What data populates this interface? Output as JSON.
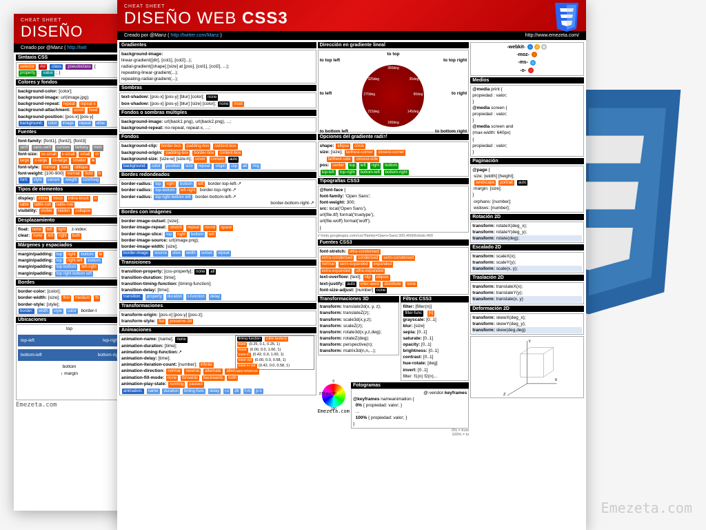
{
  "logo_alt": "CSS3",
  "header": {
    "eyebrow": "CHEAT SHEET",
    "title_a": "DISEÑO WEB ",
    "title_b": "CSS3",
    "author_label": "Creado por @Manz ( ",
    "author_url": "http://twitter.com/Manz",
    "author_close": " )",
    "site": "http://www.emezeta.com/"
  },
  "back": {
    "eyebrow": "CHEAT SHEET",
    "title": "DISEÑO",
    "author_label": "Creado por @Manz ( ",
    "author_url": "http://twit",
    "sections": {
      "sintaxis": "Sintaxis CSS",
      "sintaxis_line1": "selector #id .class :pseudoclass {",
      "sintaxis_line2": "property : value ; }",
      "colores": "Colores y fondos",
      "fuentes": "Fuentes",
      "tipos": "Tipos de elementos",
      "desplaz": "Desplazamiento",
      "margenes": "Márgenes y espaciados",
      "bordes": "Bordes",
      "ubicaciones": "Ubicaciones"
    },
    "colores_lines": [
      "background-color: [color];",
      "background-image: url(image.jpg);",
      "background-repeat: repeat repeat-x",
      "background-attachment: scroll fixed",
      "background-position: [pos-x] [pos-y]",
      "background: color image repeat attac"
    ],
    "fuentes_lines": [
      "font-family: [font1], [font2], [font3]",
      "serif sans-serif cursive fantasy mon",
      "font-size: xx-small x-small small m",
      "large x-large xx-large smaller la",
      "font-style: normal italic oblique",
      "font-weight: [100-900] normal bold b",
      "font: style variant weight size/heig"
    ],
    "tipos_lines": [
      "display: inline block inline-block n",
      "table table-cell table-row",
      "visibility: visible hidden collapse"
    ],
    "desplaz_lines": [
      "float: none left right   z-index:",
      "clear: none left right both"
    ],
    "margenes_lines": [
      "margin/padding: top right bottom le",
      "margin/padding: top left-right botto",
      "margin/padding: top-bottom left-right",
      "margin/padding: top right bottom left"
    ],
    "bordes_lines": [
      "border-color: [color];",
      "border-width: [size]; thin medium th",
      "border-style: [style];",
      "border: width style color   border-t"
    ],
    "ubic_labels": [
      "top",
      "top-left",
      "top-righ",
      "bottom-left",
      "bottom-rig",
      "bottom",
      "margin"
    ]
  },
  "front": {
    "col1": {
      "gradientes": {
        "title": "Gradientes",
        "lines": [
          "background-image:",
          "  linear-gradient([dir], [col1], [col2]...);",
          "  radial-gradient([shape] [size] at [pos], [col1], [col2], ...);",
          "  repeating-linear-gradient(...);",
          "  repeating-radial-gradient(...);"
        ]
      },
      "sombras": {
        "title": "Sombras",
        "lines": [
          "text-shadow: [pos-x] [pos-y] [blur] [color]; none",
          "box-shadow: [pos-x] [pos-y] [blur] [size] [color]; none inset"
        ]
      },
      "multiples": {
        "title": "Fondos o sombras múltiples",
        "lines": [
          "background-image: url(back1.png), url(back2.png), ...;",
          "background-repeat: no-repeat, repeat-x, ...;"
        ]
      },
      "fondos": {
        "title": "Fondos",
        "lines": [
          "background-clip: border-box padding-box content-box",
          "background-origin: padding-box border-box content-box",
          "background-size: [size-w] [size-h]; cover contain auto",
          "background: color position size repeat origin clip att img"
        ]
      },
      "bordes_r": {
        "title": "Bordes redondeados",
        "lines": [
          "border-radius: top right bottom left  border-top-left-↗",
          "border-radius: top-bottom left-right  border-top-right-↗",
          "border-radius: top right-bottom-left  border-bottom-left-↗",
          "                                       border-bottom-right-↗"
        ]
      },
      "bordes_img": {
        "title": "Bordes con imágenes",
        "lines": [
          "border-image-outset: [size];",
          "border-image-repeat: stretch repeat round space",
          "border-image-slice: top right bottom left",
          "border-image-source: url(image.png);",
          "border-image-width: [size];",
          "border-image: source slice width outset repeat"
        ]
      },
      "transiciones": {
        "title": "Transiciones",
        "lines": [
          "transition-property: [css-property]; none all",
          "transition-duration: [time];",
          "transition-timing-function: [timing-function];",
          "transition-delay: [time];",
          "transition: property duration t-function delay"
        ]
      },
      "transformaciones": {
        "title": "Transformaciones",
        "lines": [
          "transform-origin: [pos-x] [pos-y] [pos-z];",
          "transform-style: flat preserve-3d"
        ]
      },
      "animaciones": {
        "title": "Animaciones",
        "lines": [
          "animation-name: [name]; none",
          "animation-duration: [time];",
          "animation-timing-function:↗",
          "animation-delay: [time];",
          "animation-iteration-count: [number]; infinite",
          "animation-direction: normal reverse alternate alternate-reverse",
          "animation-fill-mode: none forwards backwards both",
          "animation-play-state: running paused",
          "animation: name duration timing-func delay i-c dir f-m p-s"
        ],
        "timing": {
          "title": "timing-function cubic-bezier()",
          "rows": [
            [
              "ease",
              "(0.25, 0.1, 0.25, 1)"
            ],
            [
              "linear",
              "(0.00, 0.0, 1.00, 1)"
            ],
            [
              "ease-in",
              "(0.42, 0.0, 1.00, 1)"
            ],
            [
              "ease-out",
              "(0.00, 0.0, 0.58, 1)"
            ],
            [
              "ease-in-out",
              "(0.42, 0.0, 0.58, 1)"
            ]
          ]
        }
      }
    },
    "col2": {
      "direccion": {
        "title": "Dirección en gradiente lineal",
        "labels": [
          "to top",
          "to top left",
          "to top right",
          "to left",
          "to right",
          "to bottom left",
          "to bottom right",
          "to bottom"
        ],
        "degs": [
          "360deg",
          "325deg",
          "35deg",
          "270deg",
          "90deg",
          "215deg",
          "145deg",
          "180deg"
        ]
      },
      "opciones_radial": {
        "title": "Opciones del gradiente radial",
        "lines": [
          "shape: ellipse circle",
          "size: [size]; farthest-corner closest-corner",
          "           farthest-side closest-side",
          "pos: center top left right bottom",
          "top-left top-right bottom-left bottom-right"
        ]
      },
      "tipografias": {
        "title": "Tipografías CSS3",
        "lines": [
          "@font-face {",
          "  font-family: 'Open Sans';",
          "  font-weight: 300;",
          "  src: local('Open Sans'),",
          "  url(file.ttf) format('truetype'),",
          "  url(file.woff) format('woff');",
          "}"
        ],
        "url": "// fonts.googleapis.com/css?family=Open+Sans:300,400|Roboto:400"
      },
      "fuentes_css3": {
        "title": "Fuentes CSS3",
        "lines": [
          "font-stretch: ultra-condensed",
          "extra-condensed condensed semi-condensed",
          "normal semi-expanded expanded",
          "extra-expanded ultra-expanded",
          "text-overflow: [text]; clip ellipsis",
          "text-justify: auto inter-word distribute none",
          "font-size-adjust: [number] none"
        ]
      },
      "transform3d": {
        "title": "Transformaciones 3D",
        "lines": [
          "transform: translate3d(x, y, z);",
          "transform: translateZ(z);",
          "transform: scale3d(x,y,z);",
          "transform: scaleZ(z);",
          "transform: rotate3d(x,y,z,deg);",
          "transform: rotateZ(deg);",
          "transform: perspective(n);",
          "transform: matrix3d(n,n,...);"
        ]
      },
      "filtros": {
        "title": "Filtros CSS3",
        "lines": [
          "filter: [filter(n)]",
          "filter-func    [n]",
          "grayscale: [0..1]",
          "blur: [size]",
          "sepia: [0..1]",
          "saturate: [0..1]",
          "opacity: [0..1]",
          "brightness: [0..1]",
          "contrast: [0..1]",
          "hue-rotate: [deg]",
          "invert: [0..1]",
          "filter: f1(n) f2(n)..."
        ]
      },
      "fotogramas": {
        "title": "Fotogramas",
        "lines": [
          "@-vendor-keyframes",
          "@keyframes nameanimation {",
          "  0% { propiedad: valor; }",
          "  ...",
          "  100% { propiedad: valor; }",
          "}"
        ],
        "note": "0% = from\n100% = to"
      },
      "color_wheel": {
        "labels": [
          "0",
          "270 deg 90",
          "180"
        ]
      }
    },
    "col3": {
      "prefixes": {
        "lines": [
          "-webkit-",
          "-moz-",
          "-ms-",
          "-o-"
        ]
      },
      "medios": {
        "title": "Medios",
        "lines": [
          "@media print {",
          "  propiedad : valor;",
          "}",
          "@media screen {",
          "  propiedad : valor;",
          "}",
          "@media screen and",
          "(max-width: 640px)",
          "{",
          "  propiedad : valor;",
          "}"
        ]
      },
      "paginacion": {
        "title": "Paginación",
        "lines": [
          "@page {",
          "  size: [width] [height];",
          "  landscape portrait auto",
          "  margin: [size];",
          "}",
          "  orphans: [number];",
          "  widows: [number];"
        ]
      },
      "rotacion": {
        "title": "Rotación 2D",
        "lines": [
          "transform: rotateX(deg_x);",
          "transform: rotateY(deg_y);",
          "transform: rotate(deg);"
        ]
      },
      "escalado": {
        "title": "Escalado 2D",
        "lines": [
          "transform: scaleX(x);",
          "transform: scaleY(y);",
          "transform: scale(x, y);"
        ]
      },
      "traslacion": {
        "title": "Traslación 2D",
        "lines": [
          "transform: translateX(x);",
          "transform: translateY(y);",
          "transform: translate(x, y)"
        ]
      },
      "deformacion": {
        "title": "Deformación 2D",
        "lines": [
          "transform: skewX(deg_x);",
          "transform: skewY(deg_y);",
          "transform: skew(deg,deg)"
        ]
      },
      "axes": {
        "labels": [
          "Y",
          "X",
          "Z"
        ]
      }
    }
  },
  "emezeta": "Emezeta.com",
  "emezeta_small": "Emezeta.com"
}
